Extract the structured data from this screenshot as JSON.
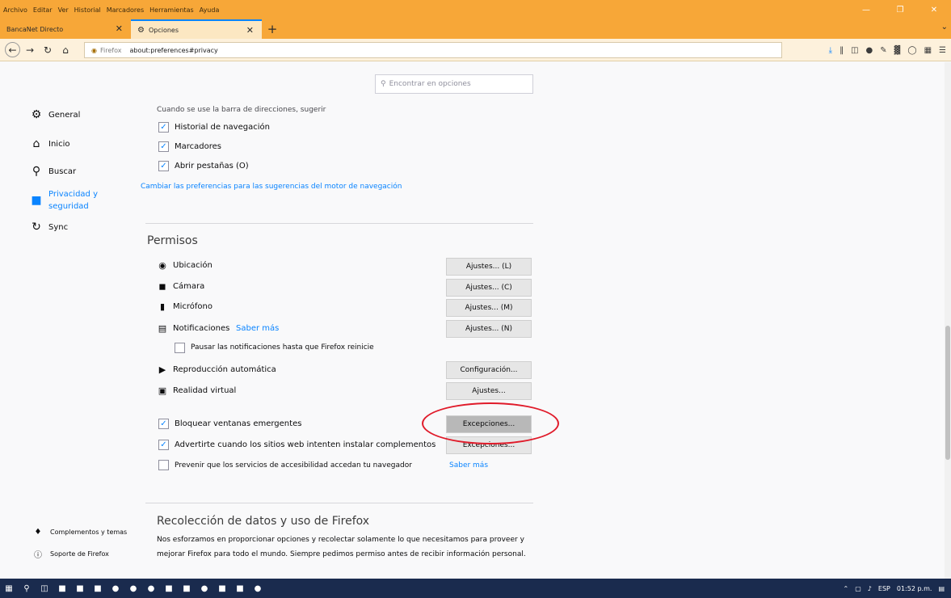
{
  "menubar": {
    "items": [
      "Archivo",
      "Editar",
      "Ver",
      "Historial",
      "Marcadores",
      "Herramientas",
      "Ayuda"
    ],
    "bg_color": "#f7a738"
  },
  "tabs": [
    {
      "label": "BancaNet Directo",
      "active": false
    },
    {
      "label": "Opciones",
      "active": true
    }
  ],
  "navbar": {
    "identity_label": "Firefox",
    "url": "about:preferences#privacy"
  },
  "search": {
    "placeholder": "Encontrar en opciones"
  },
  "sidebar": {
    "items": [
      {
        "label": "General",
        "icon": "gear-icon"
      },
      {
        "label": "Inicio",
        "icon": "home-icon"
      },
      {
        "label": "Buscar",
        "icon": "search-icon"
      },
      {
        "label": "Privacidad y seguridad",
        "icon": "lock-icon",
        "selected": true
      },
      {
        "label": "Sync",
        "icon": "sync-icon"
      }
    ],
    "footer": [
      {
        "label": "Complementos y temas",
        "icon": "puzzle-icon"
      },
      {
        "label": "Soporte de Firefox",
        "icon": "help-icon"
      }
    ]
  },
  "addressbar_section": {
    "intro": "Cuando se use la barra de direcciones, sugerir",
    "options": [
      {
        "label": "Historial de navegación",
        "checked": true
      },
      {
        "label": "Marcadores",
        "checked": true
      },
      {
        "label": "Abrir pestañas (O)",
        "checked": true
      }
    ],
    "link": "Cambiar las preferencias para las sugerencias del motor de navegación"
  },
  "permissions": {
    "heading": "Permisos",
    "items": [
      {
        "label": "Ubicación",
        "button": "Ajustes... (L)",
        "icon": "location-icon"
      },
      {
        "label": "Cámara",
        "button": "Ajustes... (C)",
        "icon": "camera-icon"
      },
      {
        "label": "Micrófono",
        "button": "Ajustes... (M)",
        "icon": "microphone-icon"
      },
      {
        "label": "Notificaciones",
        "link": "Saber más",
        "button": "Ajustes... (N)",
        "icon": "notification-icon"
      },
      {
        "label": "Reproducción automática",
        "button": "Configuración...",
        "icon": "autoplay-icon"
      },
      {
        "label": "Realidad virtual",
        "button": "Ajustes...",
        "icon": "vr-icon"
      }
    ],
    "pause_notifications": {
      "label": "Pausar las notificaciones hasta que Firefox reinicie",
      "checked": false
    },
    "checks": [
      {
        "label": "Bloquear ventanas emergentes",
        "checked": true,
        "button": "Excepciones..."
      },
      {
        "label": "Advertirte cuando los sitios web intenten instalar complementos",
        "checked": true,
        "button": "Excepciones..."
      },
      {
        "label": "Prevenir que los servicios de accesibilidad accedan tu navegador",
        "checked": false,
        "link": "Saber más"
      }
    ]
  },
  "data_collection": {
    "heading": "Recolección de datos y uso de Firefox",
    "paragraph": "Nos esforzamos en proporcionar opciones y recolectar solamente lo que necesitamos para proveer y mejorar Firefox para todo el mundo. Siempre pedimos permiso antes de recibir información personal."
  },
  "taskbar": {
    "tray": [
      "ESP",
      "01:52 p.m."
    ]
  },
  "annotation": {
    "color": "#e01b2a"
  },
  "colors": {
    "accent": "#0a84ff"
  }
}
